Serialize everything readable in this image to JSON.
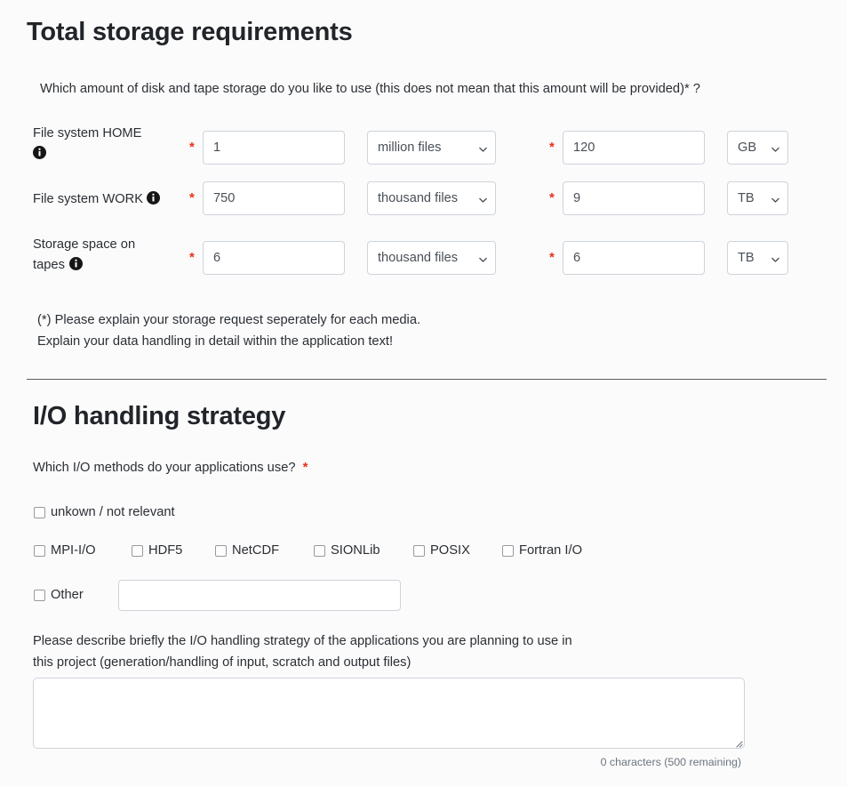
{
  "colors": {
    "page_background": "#fbfbfc",
    "heading": "#212529",
    "body_text": "#2b2f33",
    "required_star": "#e8301a",
    "input_border": "#ced4da",
    "divider": "#585c60",
    "muted_text": "#6c757d"
  },
  "storage_section": {
    "title": "Total storage requirements",
    "question": "Which amount of disk and tape storage do you like to use (this does not mean that this amount will be provided)* ?",
    "required_marker": "*",
    "info_icon_name": "info-icon",
    "rows": [
      {
        "label": "File system HOME",
        "has_info_icon": true,
        "files_value": "1",
        "files_placeholder": "",
        "files_unit": "million files",
        "capacity_value": "120",
        "capacity_placeholder": "",
        "capacity_unit": "GB"
      },
      {
        "label": "File system WORK",
        "has_info_icon": true,
        "files_value": "750",
        "files_placeholder": "",
        "files_unit": "thousand files",
        "capacity_value": "9",
        "capacity_placeholder": "",
        "capacity_unit": "TB"
      },
      {
        "label": "Storage space on tapes",
        "has_info_icon": true,
        "files_value": "6",
        "files_placeholder": "",
        "files_unit": "thousand files",
        "capacity_value": "6",
        "capacity_placeholder": "",
        "capacity_unit": "TB"
      }
    ],
    "note_line_1": "(*) Please explain your storage request seperately for each media.",
    "note_line_2": "Explain your data handling in detail within the application text!"
  },
  "io_section": {
    "title": "I/O handling strategy",
    "question": "Which I/O methods do your applications use?",
    "required_marker": "*",
    "primary_checkbox": {
      "label": "unkown / not relevant",
      "checked": false
    },
    "method_checkboxes": [
      {
        "label": "MPI-I/O",
        "checked": false
      },
      {
        "label": "HDF5",
        "checked": false
      },
      {
        "label": "NetCDF",
        "checked": false
      },
      {
        "label": "SIONLib",
        "checked": false
      },
      {
        "label": "POSIX",
        "checked": false
      },
      {
        "label": "Fortran I/O",
        "checked": false
      }
    ],
    "other_checkbox": {
      "label": "Other",
      "checked": false,
      "input_value": "",
      "input_placeholder": ""
    },
    "describe_line_1": "Please describe briefly the I/O handling strategy of the applications you are planning to use in",
    "describe_line_2": "this project (generation/handling of input, scratch and output files)",
    "description_textarea": {
      "value": "",
      "placeholder": ""
    },
    "char_counter": "0 characters (500 remaining)"
  }
}
